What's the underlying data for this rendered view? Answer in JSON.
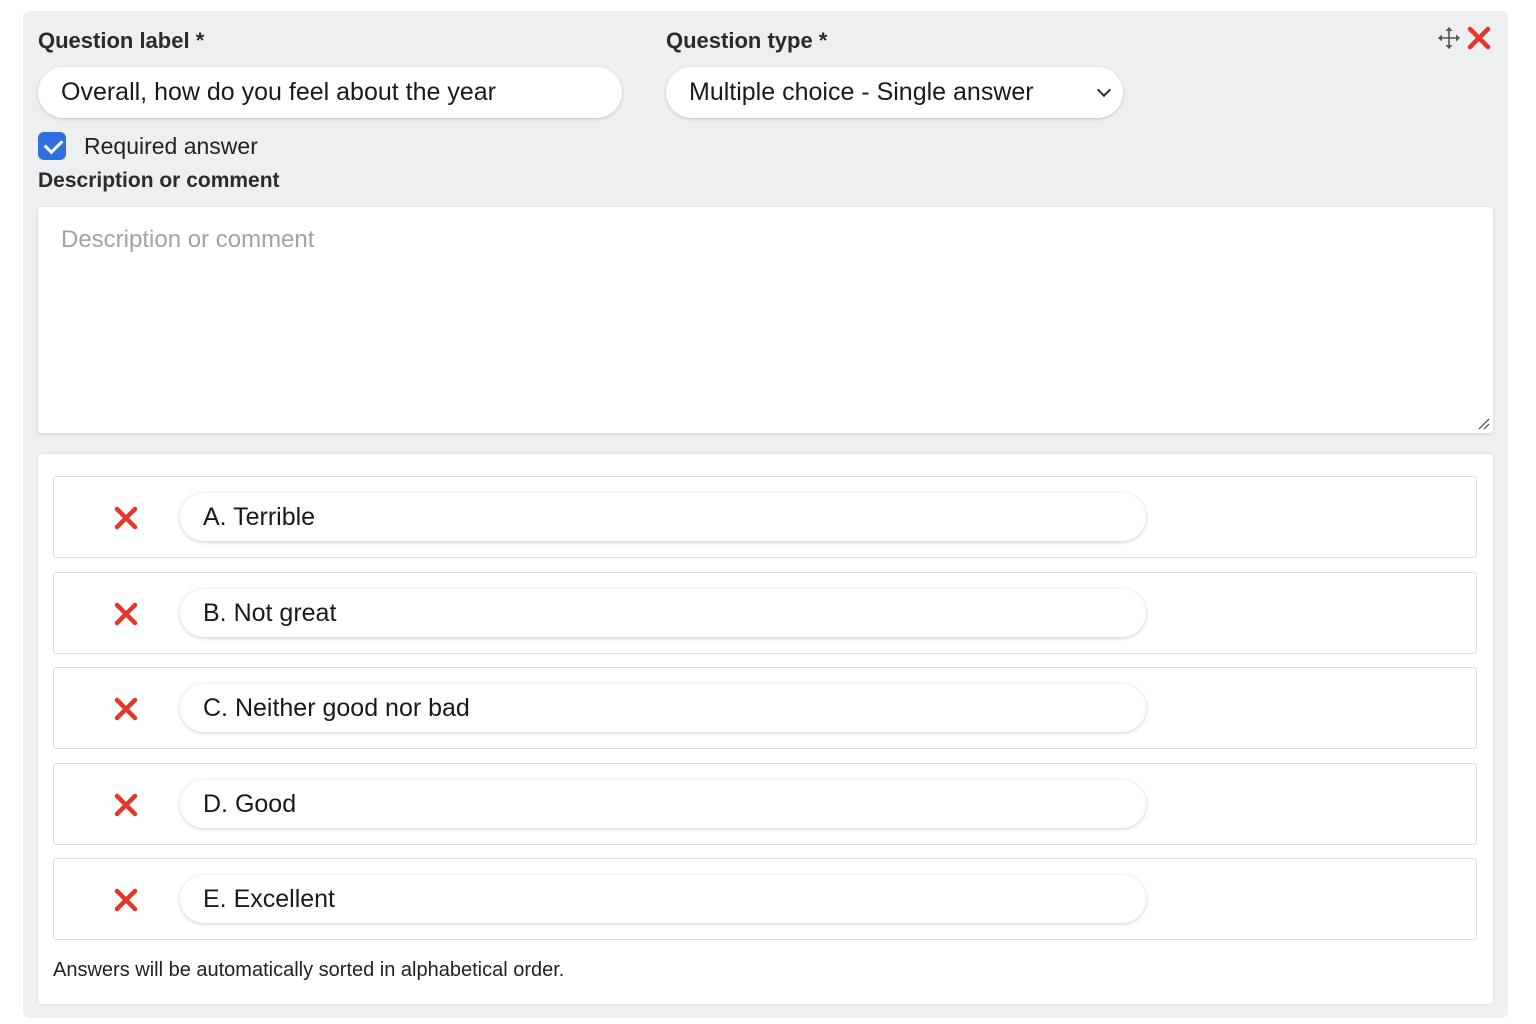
{
  "question": {
    "label_title": "Question label *",
    "label_value": "Overall, how do you feel about the year",
    "type_title": "Question type *",
    "type_value": "Multiple choice - Single answer",
    "required_label": "Required answer",
    "required_checked": true,
    "description_title": "Description or comment",
    "description_placeholder": "Description or comment"
  },
  "answers": [
    {
      "text": "A. Terrible"
    },
    {
      "text": "B. Not great"
    },
    {
      "text": "C. Neither good nor bad"
    },
    {
      "text": "D. Good"
    },
    {
      "text": "E. Excellent"
    }
  ],
  "footnote": "Answers will be automatically sorted in alphabetical order.",
  "icons": {
    "move": "move-icon",
    "close": "close-icon",
    "remove_answer": "remove-answer-icon",
    "checkbox": "check-icon",
    "chevron": "chevron-down-icon"
  },
  "colors": {
    "accent": "#2f6fdf",
    "danger": "#e0392b",
    "card_background": "#eeeff1"
  }
}
